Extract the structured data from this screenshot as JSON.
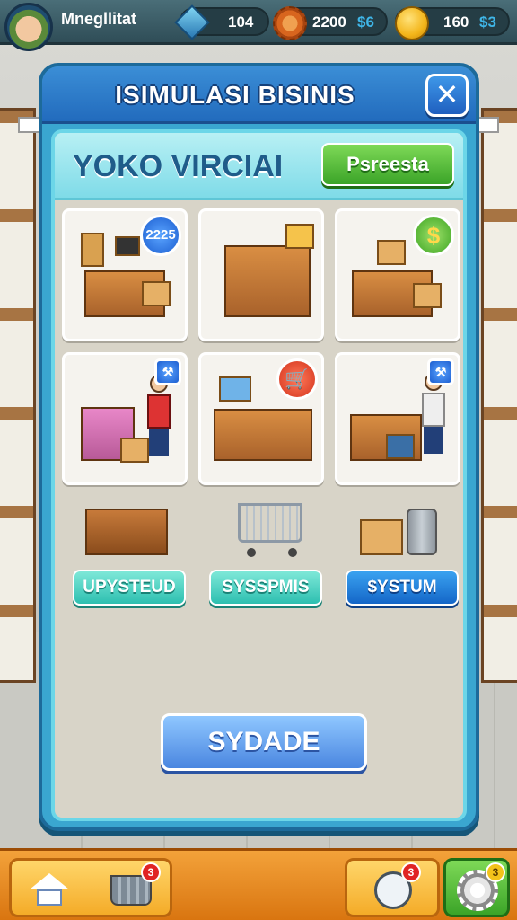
{
  "hud": {
    "player_name": "Mnegllitat",
    "resources": [
      {
        "icon": "gem-icon",
        "value": "104",
        "sub": ""
      },
      {
        "icon": "gear-icon",
        "value": "2200",
        "sub": "$6"
      },
      {
        "icon": "coin-icon",
        "value": "160",
        "sub": "$3"
      }
    ]
  },
  "panel": {
    "title": "ISIMULASI BISINIS",
    "close_label": "✕",
    "subtitle": "YOKO VIRCIAI",
    "preset_label": "Psreesta",
    "tiles": [
      {
        "badge": "2225"
      },
      {
        "badge": ""
      },
      {
        "badge": "$"
      },
      {
        "badge": "⚒"
      },
      {
        "badge": "🛒"
      },
      {
        "badge": "⚒"
      }
    ],
    "feature_labels": [
      "UPYSTEUD",
      "SYSSPMIS",
      "$YSTUM"
    ],
    "main_button": "SYDADE"
  },
  "bottom_bar": {
    "inventory_badge": "3",
    "clock_badge": "3",
    "settings_badge": "3"
  },
  "colors": {
    "panel_blue": "#3aa6d0",
    "header_blue": "#226bbd",
    "preset_green": "#3ba428",
    "accent_orange": "#f3a23a"
  }
}
